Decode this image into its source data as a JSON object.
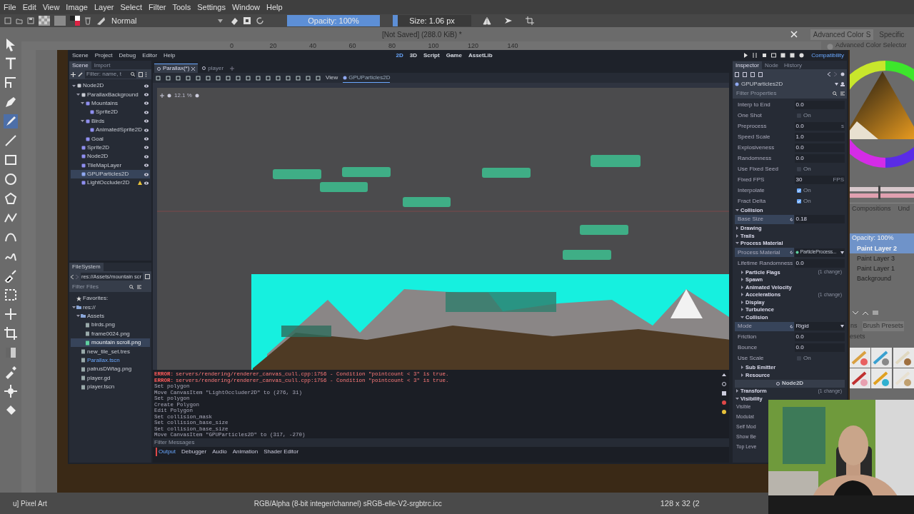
{
  "menu": [
    "File",
    "Edit",
    "View",
    "Image",
    "Layer",
    "Select",
    "Filter",
    "Tools",
    "Settings",
    "Window",
    "Help"
  ],
  "tool_options": {
    "mode": "Normal",
    "opacity": {
      "label": "Opacity: 100%",
      "level": 1
    },
    "size": {
      "label": "Size: 1.06 px",
      "level": 0.06
    }
  },
  "document": {
    "info": "[Not Saved]  (288.0 KiB) *",
    "ruler": [
      "0",
      "20",
      "40",
      "60",
      "80",
      "100",
      "120",
      "140"
    ]
  },
  "godot": {
    "menu": [
      "Scene",
      "Project",
      "Debug",
      "Editor",
      "Help"
    ],
    "workspaces": [
      {
        "label": "2D",
        "selected": true
      },
      {
        "label": "3D",
        "selected": false
      },
      {
        "label": "Script",
        "selected": false
      },
      {
        "label": "Game",
        "selected": false
      },
      {
        "label": "AssetLib",
        "selected": false
      }
    ],
    "renderer": "Compatibility",
    "scene_dock": {
      "tabs": [
        {
          "label": "Scene",
          "selected": true
        },
        {
          "label": "Import",
          "selected": false
        }
      ],
      "filter_placeholder": "Filter: name, t",
      "tree": [
        {
          "name": "Node2D",
          "color": "#c8cbd3",
          "selected": false,
          "warning": false,
          "expanded": true,
          "children": [
            {
              "name": "ParallaxBackground",
              "color": "#c8cbd3",
              "selected": false,
              "warning": false,
              "expanded": true,
              "children": [
                {
                  "name": "Mountains",
                  "color": "#8f8ff0",
                  "selected": false,
                  "warning": false,
                  "expanded": true,
                  "children": [
                    {
                      "name": "Sprite2D",
                      "color": "#8f8ff0",
                      "selected": false,
                      "warning": false
                    }
                  ]
                },
                {
                  "name": "Birds",
                  "color": "#8f8ff0",
                  "selected": false,
                  "warning": false,
                  "expanded": true,
                  "children": [
                    {
                      "name": "AnimatedSprite2D",
                      "color": "#8f8ff0",
                      "selected": false,
                      "warning": false
                    }
                  ]
                },
                {
                  "name": "Goal",
                  "color": "#8f8ff0",
                  "selected": false,
                  "warning": false
                }
              ]
            },
            {
              "name": "Sprite2D",
              "color": "#8f8ff0",
              "selected": false,
              "warning": false
            },
            {
              "name": "Node2D",
              "color": "#8f8ff0",
              "selected": false,
              "warning": false
            },
            {
              "name": "TileMapLayer",
              "color": "#8f8ff0",
              "selected": false,
              "warning": false
            },
            {
              "name": "GPUParticles2D",
              "color": "#8fa8f0",
              "selected": true,
              "warning": false
            },
            {
              "name": "LightOccluder2D",
              "color": "#8f8ff0",
              "selected": false,
              "warning": true
            }
          ]
        }
      ]
    },
    "filesystem": {
      "tab": "FileSystem",
      "path": "res://Assets/mountain scr",
      "filter_placeholder": "Filter Files",
      "tree": [
        {
          "name": "Favorites:",
          "kind": "favorites",
          "selected": false,
          "current": false
        },
        {
          "name": "res://",
          "kind": "folder",
          "selected": false,
          "current": false,
          "expanded": true,
          "children": [
            {
              "name": "Assets",
              "kind": "folder",
              "selected": false,
              "current": false,
              "expanded": true,
              "children": [
                {
                  "name": "birds.png",
                  "kind": "file",
                  "selected": false,
                  "current": false
                },
                {
                  "name": "frame0024.png",
                  "kind": "file",
                  "selected": false,
                  "current": false
                },
                {
                  "name": "mountain scroll.png",
                  "kind": "file",
                  "selected": true,
                  "current": false
                }
              ]
            },
            {
              "name": "new_tile_set.tres",
              "kind": "file",
              "selected": false,
              "current": false
            },
            {
              "name": "Parallax.tscn",
              "kind": "file",
              "selected": false,
              "current": true
            },
            {
              "name": "patrusDWtag.png",
              "kind": "file",
              "selected": false,
              "current": false
            },
            {
              "name": "player.gd",
              "kind": "file",
              "selected": false,
              "current": false
            },
            {
              "name": "player.tscn",
              "kind": "file",
              "selected": false,
              "current": false
            }
          ]
        }
      ]
    },
    "scene_tabs": [
      {
        "label": "Parallax(*)",
        "selected": true
      },
      {
        "label": "player",
        "selected": false
      }
    ],
    "viewport_toolbar": {
      "view": "View",
      "node": "GPUParticles2D"
    },
    "zoom": "12.1 %",
    "output": {
      "lines": [
        {
          "kind": "error",
          "tag": "ERROR:",
          "text": "servers/rendering/renderer_canvas_cull.cpp:1756 - Condition \"pointcount < 3\" is true."
        },
        {
          "kind": "error",
          "tag": "ERROR:",
          "text": "servers/rendering/renderer_canvas_cull.cpp:1756 - Condition \"pointcount < 3\" is true."
        },
        {
          "kind": "info",
          "text": "Set polygon"
        },
        {
          "kind": "info",
          "text": "Move CanvasItem \"LightOccluder2D\" to (276, 31)"
        },
        {
          "kind": "info",
          "text": "Set polygon"
        },
        {
          "kind": "info",
          "text": "Create Polygon"
        },
        {
          "kind": "info",
          "text": "Edit Polygon"
        },
        {
          "kind": "info",
          "text": "Set collision_mask"
        },
        {
          "kind": "info",
          "text": "Set collision_base_size"
        },
        {
          "kind": "info",
          "text": "Set collision_base_size"
        },
        {
          "kind": "info",
          "text": "Move CanvasItem \"GPUParticles2D\" to (317, -270)"
        }
      ],
      "filter_placeholder": "Filter Messages",
      "tabs": [
        {
          "label": "Output",
          "selected": true
        },
        {
          "label": "Debugger",
          "selected": false
        },
        {
          "label": "Audio",
          "selected": false
        },
        {
          "label": "Animation",
          "selected": false
        },
        {
          "label": "Shader Editor",
          "selected": false
        }
      ]
    },
    "inspector": {
      "tabs": [
        {
          "label": "Inspector",
          "selected": true
        },
        {
          "label": "Node",
          "selected": false
        },
        {
          "label": "History",
          "selected": false
        }
      ],
      "node": "GPUParticles2D",
      "filter_placeholder": "Filter Properties",
      "rows": [
        {
          "kind": "prop",
          "label": "Interp to End",
          "value": "0.0",
          "modified": false
        },
        {
          "kind": "check",
          "label": "One Shot",
          "value": "On",
          "checked": false
        },
        {
          "kind": "prop",
          "label": "Preprocess",
          "value": "0.0",
          "suffix": "s",
          "modified": false
        },
        {
          "kind": "prop",
          "label": "Speed Scale",
          "value": "1.0",
          "modified": false
        },
        {
          "kind": "prop",
          "label": "Explosiveness",
          "value": "0.0",
          "modified": false
        },
        {
          "kind": "prop",
          "label": "Randomness",
          "value": "0.0",
          "modified": false
        },
        {
          "kind": "check",
          "label": "Use Fixed Seed",
          "value": "On",
          "checked": false
        },
        {
          "kind": "prop",
          "label": "Fixed FPS",
          "value": "30",
          "suffix": "FPS",
          "modified": false
        },
        {
          "kind": "check",
          "label": "Interpolate",
          "value": "On",
          "checked": true
        },
        {
          "kind": "check",
          "label": "Fract Delta",
          "value": "On",
          "checked": true
        },
        {
          "kind": "section",
          "label": "Collision",
          "expanded": true
        },
        {
          "kind": "prop",
          "label": "Base Size",
          "value": "0.18",
          "modified": true
        },
        {
          "kind": "section",
          "label": "Drawing",
          "expanded": false
        },
        {
          "kind": "section",
          "label": "Trails",
          "expanded": false
        },
        {
          "kind": "section",
          "label": "Process Material",
          "expanded": true
        },
        {
          "kind": "resource",
          "label": "Process Material",
          "value": "ParticleProcess...",
          "modified": true
        },
        {
          "kind": "prop",
          "label": "Lifetime Randomness",
          "value": "0.0",
          "modified": false
        },
        {
          "kind": "group",
          "label": "Particle Flags",
          "expanded": false,
          "note": "(1 change)"
        },
        {
          "kind": "group",
          "label": "Spawn",
          "expanded": false
        },
        {
          "kind": "group",
          "label": "Animated Velocity",
          "expanded": false
        },
        {
          "kind": "group",
          "label": "Accelerations",
          "expanded": false,
          "note": "(1 change)"
        },
        {
          "kind": "group",
          "label": "Display",
          "expanded": false
        },
        {
          "kind": "group",
          "label": "Turbulence",
          "expanded": false
        },
        {
          "kind": "group",
          "label": "Collision",
          "expanded": true
        },
        {
          "kind": "enum",
          "label": "Mode",
          "value": "Rigid",
          "modified": true
        },
        {
          "kind": "prop",
          "label": "Friction",
          "value": "0.0",
          "modified": false
        },
        {
          "kind": "prop",
          "label": "Bounce",
          "value": "0.0",
          "modified": false
        },
        {
          "kind": "check",
          "label": "Use Scale",
          "value": "On",
          "checked": false
        },
        {
          "kind": "group",
          "label": "Sub Emitter",
          "expanded": false
        },
        {
          "kind": "group",
          "label": "Resource",
          "expanded": false
        },
        {
          "kind": "header",
          "label": "Node2D"
        },
        {
          "kind": "section",
          "label": "Transform",
          "expanded": false,
          "note": "(1 change)"
        },
        {
          "kind": "section",
          "label": "Visibility",
          "expanded": true
        },
        {
          "kind": "label",
          "label": "Visible"
        },
        {
          "kind": "label",
          "label": "Modulat"
        },
        {
          "kind": "label",
          "label": "Self Mod"
        },
        {
          "kind": "label",
          "label": "Show Be"
        },
        {
          "kind": "label",
          "label": "Top Leve"
        }
      ]
    }
  },
  "right_dock": {
    "tabs": [
      {
        "label": "Advanced Color S",
        "selected": true
      },
      {
        "label": "Specific",
        "selected": false
      }
    ],
    "selector_title": "Advanced Color Selector",
    "panel_tabs": [
      {
        "label": "Compositions",
        "selected": false
      },
      {
        "label": "Und",
        "selected": false
      }
    ],
    "opacity": {
      "label": "Opacity:  100%",
      "level": 1
    },
    "layers": [
      {
        "name": "Paint Layer 2",
        "selected": true
      },
      {
        "name": "Paint Layer 3",
        "selected": false
      },
      {
        "name": "Paint Layer 1",
        "selected": false
      },
      {
        "name": "Background",
        "selected": false
      }
    ],
    "preset_tabs": [
      {
        "label": "ns",
        "selected": false
      },
      {
        "label": "Brush Presets",
        "selected": true
      }
    ],
    "preset_label": "esets"
  },
  "status_bar": {
    "left": "u] Pixel Art",
    "center": "RGB/Alpha (8-bit integer/channel)  sRGB-elle-V2-srgbtrc.icc",
    "right": "128 x 32 (2"
  }
}
